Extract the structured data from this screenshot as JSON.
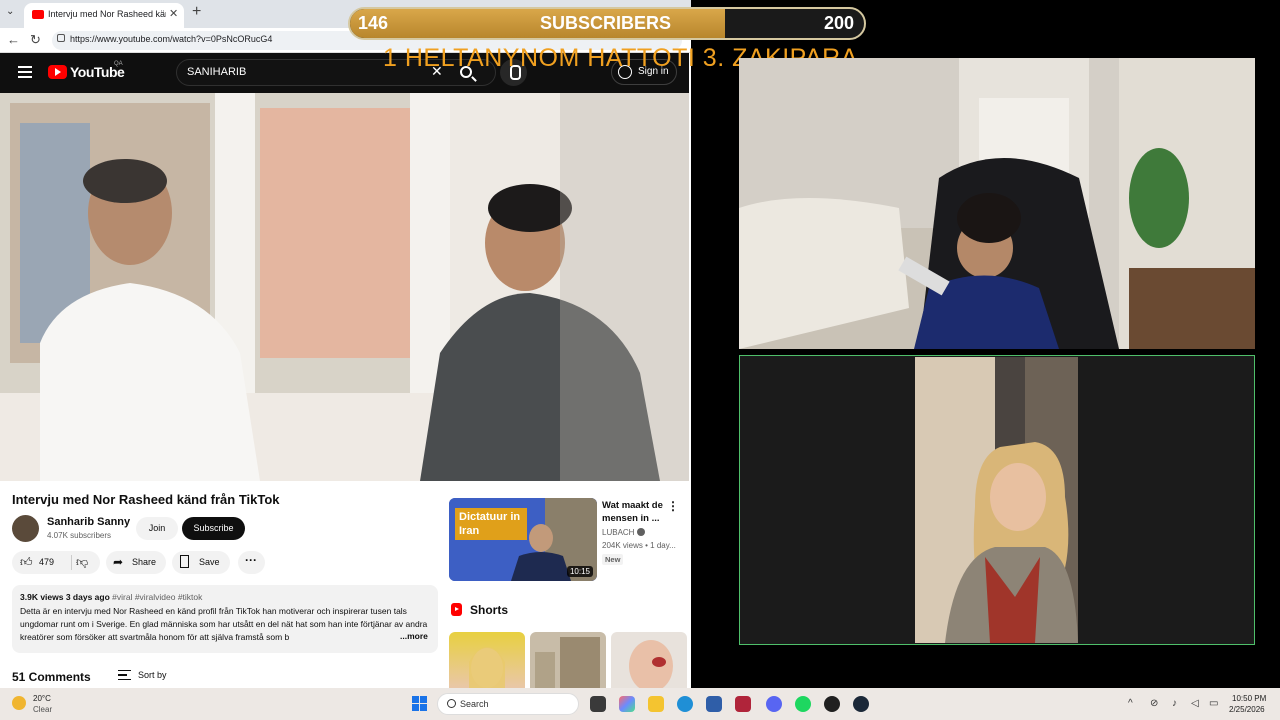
{
  "browser": {
    "tab_title": "Intervju med Nor Rasheed känd från TikTok",
    "tab_close": "✕",
    "new_tab": "+",
    "url": "https://www.youtube.com/watch?v=0PsNcORucG4"
  },
  "youtube": {
    "logo": "YouTube",
    "region": "QA",
    "search_value": "SANIHARIB",
    "sign_in": "Sign in"
  },
  "video": {
    "title": "Intervju med Nor Rasheed känd från TikTok",
    "channel": "Sanharib Sanny",
    "subscribers": "4.07K subscribers",
    "join": "Join",
    "subscribe": "Subscribe",
    "likes": "479",
    "share": "Share",
    "save": "Save",
    "views_date": "3.9K views  3 days ago",
    "tags": "#viral #viralvideo #tiktok",
    "description": "Detta är en intervju med Nor Rasheed en känd profil från TikTok han motiverar och inspirerar tusen tals ungdomar runt om i Sverige. En glad människa som har utsått en del nät hat som han inte förtjänar av andra kreatörer som försöker att svartmåla honom för att själva framstå som b",
    "more": "...more",
    "comments": "51 Comments",
    "sort_by": "Sort by"
  },
  "recommended": {
    "thumb_label": "Dictatuur in Iran",
    "duration": "10:15",
    "title": "Wat maakt de mensen in ...",
    "channel": "LUBACH",
    "stats": "204K views • 1 day...",
    "badge": "New"
  },
  "shorts": {
    "title": "Shorts"
  },
  "overlay": {
    "sub_current": "146",
    "sub_label": "SUBSCRIBERS",
    "sub_goal": "200",
    "sub_progress": 0.73,
    "ticker": "1 HELTANYNOM  HATTOTI  3.  ZAKIPARA"
  },
  "taskbar": {
    "temp": "20°C",
    "condition": "Clear",
    "search": "Search",
    "time": "10:50 PM",
    "date": "2/25/2026"
  },
  "colors": {
    "youtube_red": "#ff0000",
    "overlay_gold": "#d9a74a",
    "ticker": "#f0a020",
    "cam_border": "#4fbf6a"
  }
}
